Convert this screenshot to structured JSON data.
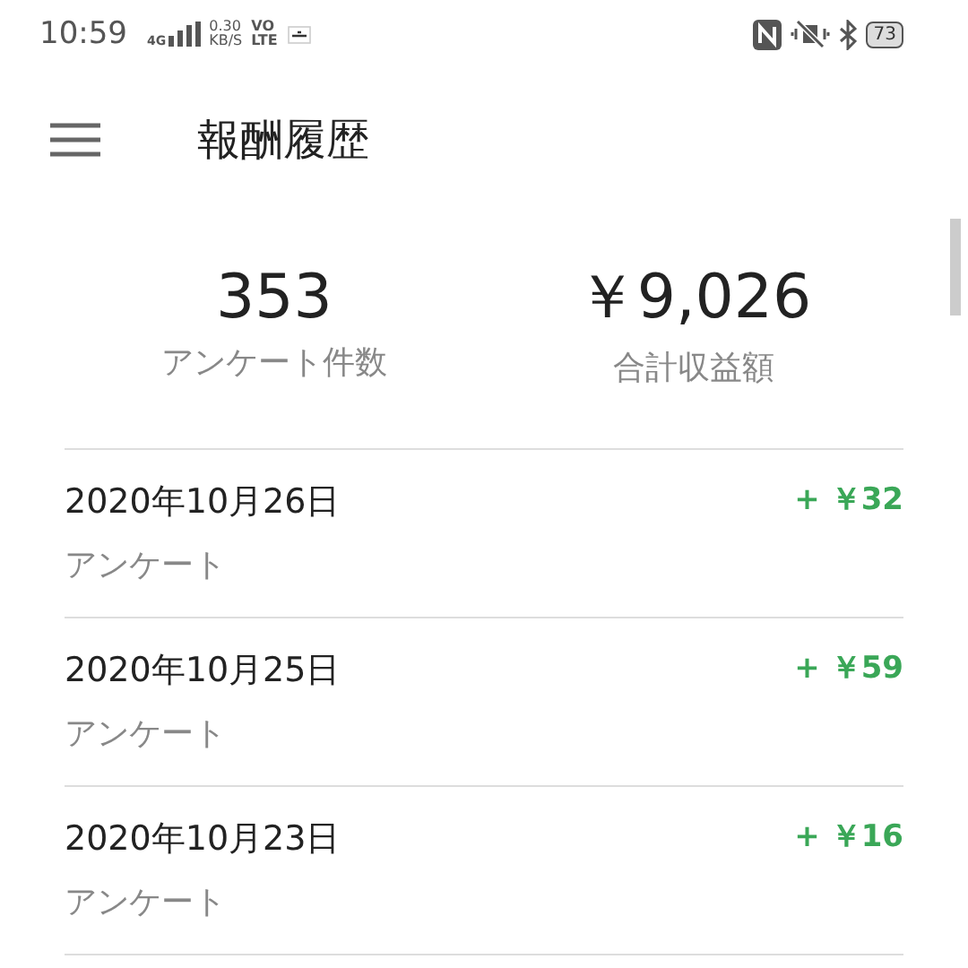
{
  "status_bar": {
    "time": "10:59",
    "network": "4G",
    "speed_value": "0.30",
    "speed_unit": "KB/S",
    "volte_top": "VO",
    "volte_bottom": "LTE",
    "battery": "73"
  },
  "header": {
    "title": "報酬履歴"
  },
  "summary": [
    {
      "value": "353",
      "label": "アンケート件数"
    },
    {
      "value": "￥9,026",
      "label": "合計収益額"
    }
  ],
  "history": [
    {
      "date": "2020年10月26日",
      "type": "アンケート",
      "amount": "+ ￥32"
    },
    {
      "date": "2020年10月25日",
      "type": "アンケート",
      "amount": "+ ￥59"
    },
    {
      "date": "2020年10月23日",
      "type": "アンケート",
      "amount": "+ ￥16"
    }
  ]
}
